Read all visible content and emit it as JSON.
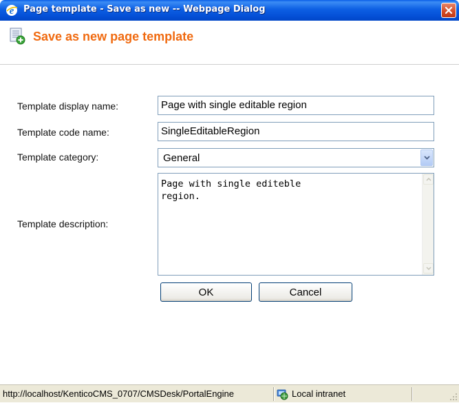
{
  "window": {
    "title": "Page template - Save as new -- Webpage Dialog",
    "close_icon": "close-icon"
  },
  "header": {
    "title": "Save as new page template",
    "icon": "template-add-icon",
    "title_color": "#f06a10"
  },
  "form": {
    "display_name": {
      "label": "Template display name:",
      "value": "Page with single editable region"
    },
    "code_name": {
      "label": "Template code name:",
      "value": "SingleEditableRegion"
    },
    "category": {
      "label": "Template category:",
      "selected": "General"
    },
    "description": {
      "label": "Template description:",
      "value": "Page with single editeble\nregion."
    }
  },
  "buttons": {
    "ok_label": "OK",
    "cancel_label": "Cancel"
  },
  "statusbar": {
    "url": "http://localhost/KenticoCMS_0707/CMSDesk/PortalEngine",
    "zone": "Local intranet",
    "zone_icon": "local-intranet-icon"
  }
}
